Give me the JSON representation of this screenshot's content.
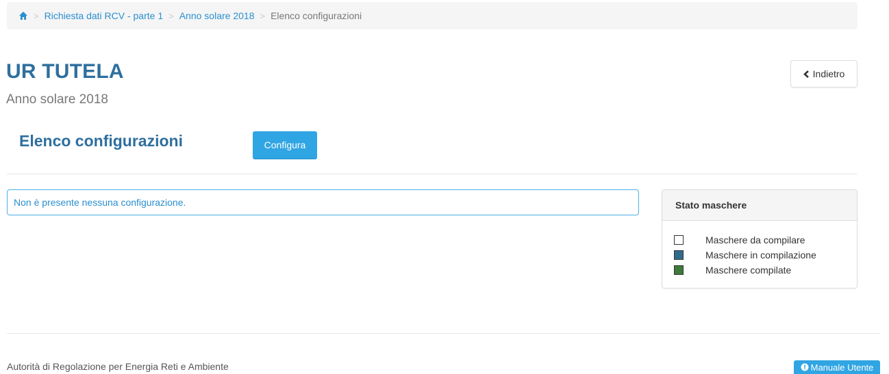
{
  "breadcrumb": {
    "home_icon": "home-icon",
    "items": [
      {
        "label": "Richiesta dati RCV - parte 1"
      },
      {
        "label": "Anno solare 2018"
      },
      {
        "label": "Elenco configurazioni"
      }
    ],
    "separator": ">"
  },
  "header": {
    "title": "UR TUTELA",
    "subtitle": "Anno solare 2018",
    "back_label": "Indietro",
    "back_icon": "chevron-left-icon"
  },
  "section": {
    "title": "Elenco configurazioni",
    "configure_label": "Configura"
  },
  "alert": {
    "message": "Non è presente nessuna configurazione."
  },
  "status_panel": {
    "title": "Stato maschere",
    "legend": [
      {
        "label": "Maschere da compilare",
        "color": "#ffffff"
      },
      {
        "label": "Maschere in compilazione",
        "color": "#2f6b8c"
      },
      {
        "label": "Maschere compilate",
        "color": "#3e7a3a"
      }
    ]
  },
  "footer": {
    "text": "Autorità di Regolazione per Energia Reti e Ambiente",
    "manual_label": "Manuale Utente",
    "manual_icon": "info-circle-icon"
  },
  "colors": {
    "accent": "#30a5e3",
    "title": "#2e6f9e",
    "link": "#2a8fd0"
  }
}
